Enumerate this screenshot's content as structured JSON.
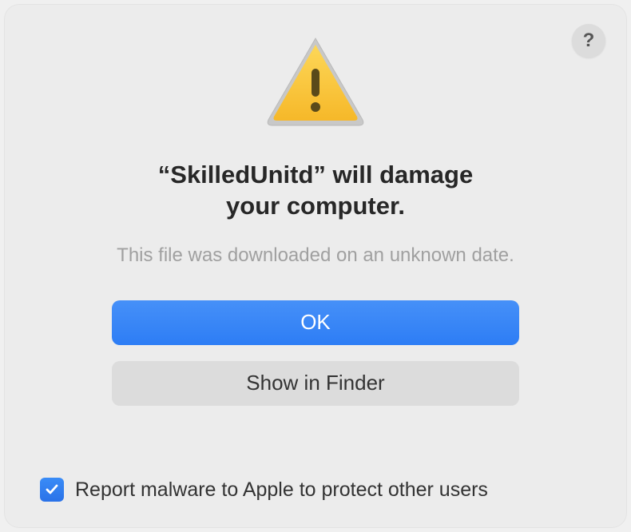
{
  "dialog": {
    "help_symbol": "?",
    "title_line1": "“SkilledUnitd” will damage",
    "title_line2": "your computer.",
    "subtitle": "This file was downloaded on an unknown date.",
    "primary_button": "OK",
    "secondary_button": "Show in Finder",
    "checkbox_label": "Report malware to Apple to protect other users",
    "checkbox_checked": true
  }
}
